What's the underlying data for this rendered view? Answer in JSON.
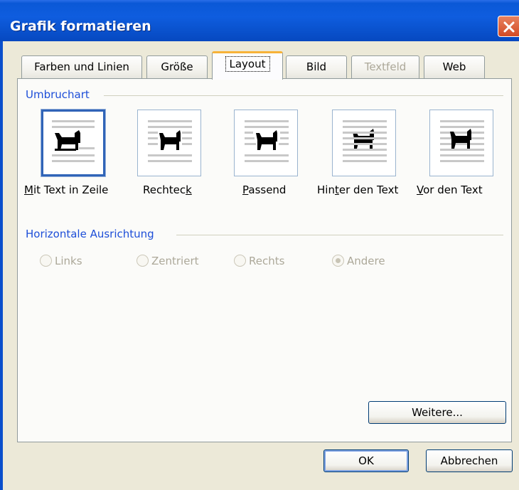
{
  "window": {
    "title": "Grafik formatieren"
  },
  "tabs": [
    {
      "label": "Farben und Linien",
      "state": "normal"
    },
    {
      "label": "Größe",
      "state": "normal"
    },
    {
      "label": "Layout",
      "state": "active"
    },
    {
      "label": "Bild",
      "state": "normal"
    },
    {
      "label": "Textfeld",
      "state": "disabled"
    },
    {
      "label": "Web",
      "state": "normal"
    }
  ],
  "wrapping": {
    "group_label": "Umbruchart",
    "options": [
      {
        "label": "Mit Text in Zeile",
        "access_key": "M",
        "selected": true,
        "icon": "inline-with-text-icon"
      },
      {
        "label": "Rechteck",
        "access_key": "k",
        "selected": false,
        "icon": "square-wrap-icon"
      },
      {
        "label": "Passend",
        "access_key": "P",
        "selected": false,
        "icon": "tight-wrap-icon"
      },
      {
        "label": "Hinter den Text",
        "access_key": "t",
        "selected": false,
        "icon": "behind-text-icon"
      },
      {
        "label": "Vor den Text",
        "access_key": "V",
        "selected": false,
        "icon": "in-front-of-text-icon"
      }
    ]
  },
  "alignment": {
    "group_label": "Horizontale Ausrichtung",
    "options": [
      {
        "label": "Links",
        "checked": false
      },
      {
        "label": "Zentriert",
        "checked": false
      },
      {
        "label": "Rechts",
        "checked": false
      },
      {
        "label": "Andere",
        "checked": true
      }
    ],
    "enabled": false
  },
  "buttons": {
    "more": "Weitere...",
    "ok": "OK",
    "cancel": "Abbrechen"
  },
  "colors": {
    "titlebar": "#0a58d6",
    "group_label": "#1d4ed8",
    "active_tab_accent": "#f7b238",
    "selection_border": "#3064b8"
  }
}
